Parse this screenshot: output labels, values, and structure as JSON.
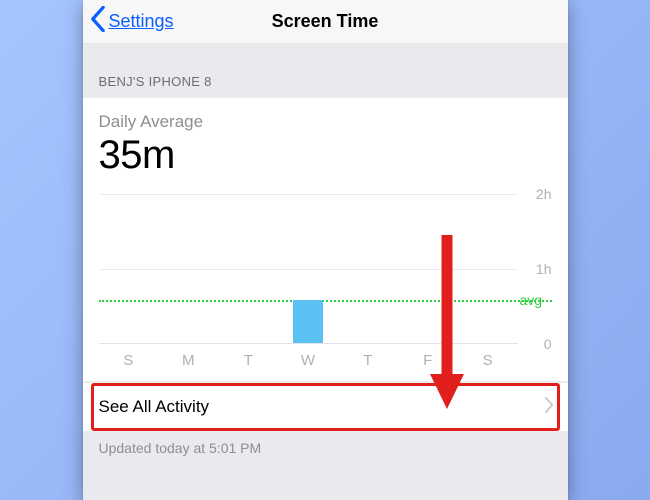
{
  "nav": {
    "back_label": "Settings",
    "title": "Screen Time"
  },
  "section_header": "BENJ'S IPHONE 8",
  "summary": {
    "label": "Daily Average",
    "value": "35m"
  },
  "chart_data": {
    "type": "bar",
    "categories": [
      "S",
      "M",
      "T",
      "W",
      "T",
      "F",
      "S"
    ],
    "values": [
      0,
      0,
      0,
      35,
      0,
      0,
      0
    ],
    "ylabel": "",
    "xlabel": "",
    "ylim": [
      0,
      120
    ],
    "yticks": [
      {
        "v": 120,
        "label": "2h"
      },
      {
        "v": 60,
        "label": "1h"
      },
      {
        "v": 0,
        "label": "0"
      }
    ],
    "avg_value": 35,
    "avg_label": "avg"
  },
  "see_all_label": "See All Activity",
  "updated_text": "Updated today at 5:01 PM",
  "colors": {
    "ios_blue": "#0a60ff",
    "bar_fill": "#5ac1f2",
    "avg_green": "#2ecc40",
    "highlight_red": "#e1201d"
  }
}
